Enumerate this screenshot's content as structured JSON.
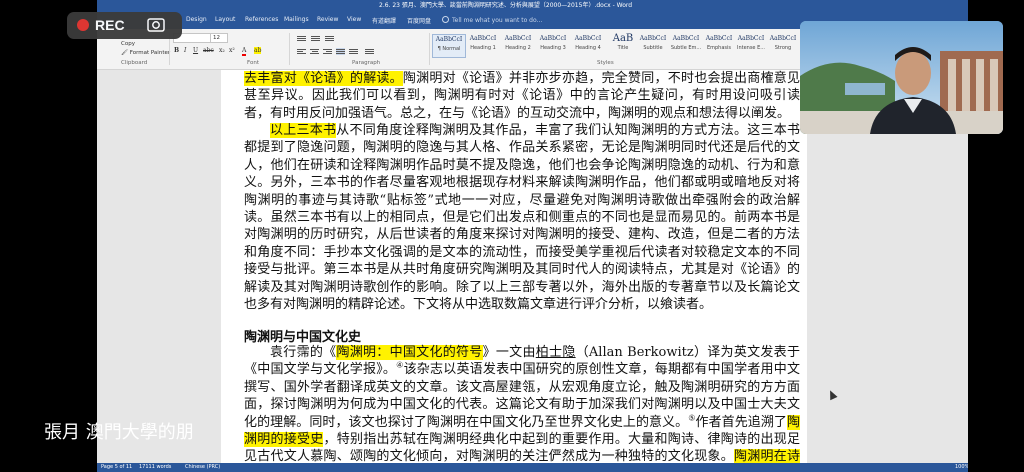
{
  "window": {
    "title": "2.6. 23 張月、澳門大學、談當前陶淵明研究述、分析與展望（2000—2015年）.docx - Word"
  },
  "ribbon_tabs": [
    "Design",
    "Layout",
    "References",
    "Mailings",
    "Review",
    "View",
    "有道翻譯",
    "百度网盘"
  ],
  "tell_me": "Tell me what you want to do...",
  "clipboard": {
    "copy": "Copy",
    "format_painter": "Format Painter",
    "label": "Clipboard"
  },
  "font": {
    "size": "12",
    "label": "Font"
  },
  "paragraph_label": "Paragraph",
  "styles": {
    "label": "Styles",
    "items": [
      {
        "sample": "AaBbCcI",
        "name": "¶ Normal"
      },
      {
        "sample": "AaBbCcI",
        "name": "Heading 1"
      },
      {
        "sample": "AaBbCcI",
        "name": "Heading 2"
      },
      {
        "sample": "AaBbCcI",
        "name": "Heading 3"
      },
      {
        "sample": "AaBbCcI",
        "name": "Heading 4"
      },
      {
        "sample": "AaB",
        "name": "Title"
      },
      {
        "sample": "AaBbCcI",
        "name": "Subtitle"
      },
      {
        "sample": "AaBbCcI",
        "name": "Subtle Em..."
      },
      {
        "sample": "AaBbCcI",
        "name": "Emphasis"
      },
      {
        "sample": "AaBbCcI",
        "name": "Intense E..."
      },
      {
        "sample": "AaBbCcI",
        "name": "Strong"
      }
    ]
  },
  "document": {
    "para1": {
      "highlight": "去丰富对《论语》的解读。",
      "text": "陶渊明对《论语》并非亦步亦趋，完全赞同，不时也会提出商榷意见甚至异议。因此我们可以看到，陶渊明有时对《论语》中的言论产生疑问，有时用设问吸引读者，有时用反问加强语气。总之，在与《论语》的互动交流中，陶渊明的观点和想法得以阐发。"
    },
    "para2": {
      "highlight": "以上三本书",
      "text": "从不同角度诠释陶渊明及其作品，丰富了我们认知陶渊明的方式方法。这三本书都提到了隐逸问题，陶渊明的隐逸与其人格、作品关系紧密，无论是陶渊明同时代还是后代的文人，他们在研读和诠释陶渊明作品时莫不提及隐逸，他们也会争论陶渊明隐逸的动机、行为和意义。另外，三本书的作者尽量客观地根据现存材料来解读陶渊明作品，他们都或明或暗地反对将陶渊明的事迹与其诗歌“贴标签”式地一一对应，尽量避免对陶渊明诗歌做出牵强附会的政治解读。虽然三本书有以上的相同点，但是它们出发点和侧重点的不同也是显而易见的。前两本书是对陶渊明的历时研究，从后世读者的角度来探讨对陶渊明的接受、建构、改造，但是二者的方法和角度不同：手抄本文化强调的是文本的流动性，而接受美学重视后代读者对较稳定文本的不同接受与批评。第三本书是从共时角度研究陶渊明及其同时代人的阅读特点，尤其是对《论语》的解读及其对陶渊明诗歌创作的影响。除了以上三部专著以外，海外出版的专著章节以及长篇论文也多有对陶渊明的精辟论述。下文将从中选取数篇文章进行评介分析，以飨读者。"
    },
    "heading": "陶渊明与中国文化史",
    "para3": {
      "t1": "袁行霈的《",
      "h1": "陶渊明：中国文化的符号",
      "t2": "》一文由",
      "name": "柏士隐",
      "t3": "（Allan Berkowitz）译为英文发表于《中国文学与文化学报》。",
      "note1": "④",
      "t4": "该杂志以英语发表中国研究的原创性文章，每期都有中国学者用中文撰写、国外学者翻译成英文的文章。该文高屋建瓴，从宏观角度立论，触及陶渊明研究的方方面面，探讨陶渊明为何成为中国文化的代表。这篇论文有助于加深我们对陶渊明以及中国士大夫文化的理解。同时，该文也探讨了陶渊明在中国文化乃至世界文化史上的意义。",
      "note2": "⑤",
      "t5": "作者首先追溯了",
      "h2": "陶渊明的接受史",
      "t6": "，特别指出苏轼在陶渊明经典化中起到的重要作用。大量和陶诗、律陶诗的出现足见古代文人慕陶、颂陶的文化倾向，对陶渊明的关注俨然成为一种独特的文化现象。",
      "h3": "陶渊明在诗歌、绘画、书法中的"
    }
  },
  "status_bar": {
    "page": "Page 5 of 11",
    "words": "17111 words",
    "language": "Chinese (PRC)",
    "zoom": "100%"
  },
  "rec_overlay": {
    "label": "REC"
  },
  "speaker_name": "張月 澳門大學的朋"
}
